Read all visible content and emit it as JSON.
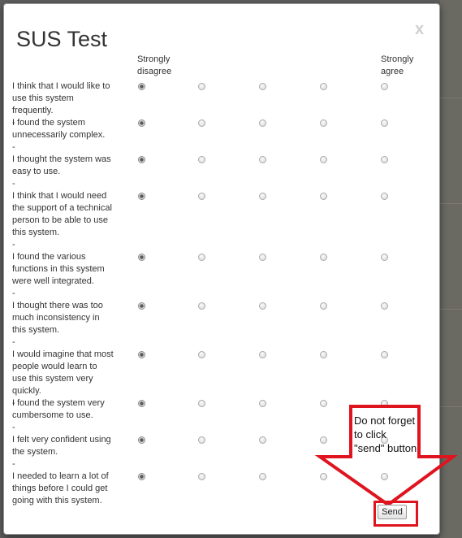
{
  "dialog": {
    "title": "SUS Test",
    "close_label": "x"
  },
  "scale": {
    "low_label": "Strongly disagree",
    "high_label": "Strongly agree"
  },
  "questions": [
    {
      "text": "I think that I would like to use this system frequently.",
      "selected": 1
    },
    {
      "text": "I found the system unnecessarily complex.",
      "selected": 1
    },
    {
      "text": "I thought the system was easy to use.",
      "selected": 1
    },
    {
      "text": "I think that I would need the support of a technical person to be able to use this system.",
      "selected": 1
    },
    {
      "text": "I found the various functions in this system were well integrated.",
      "selected": 1
    },
    {
      "text": "I thought there was too much inconsistency in this system.",
      "selected": 1
    },
    {
      "text": "I would imagine that most people would learn to use this system very quickly.",
      "selected": 1
    },
    {
      "text": "I found the system very cumbersome to use.",
      "selected": 1
    },
    {
      "text": "I felt very confident using the system.",
      "selected": 1
    },
    {
      "text": "I needed to learn a lot of things before I could get going with this system.",
      "selected": 1
    }
  ],
  "separator": "-",
  "send_label": "Send",
  "annotation": {
    "note": "Do not forget to click \"send\" button",
    "color": "#e0141e"
  }
}
